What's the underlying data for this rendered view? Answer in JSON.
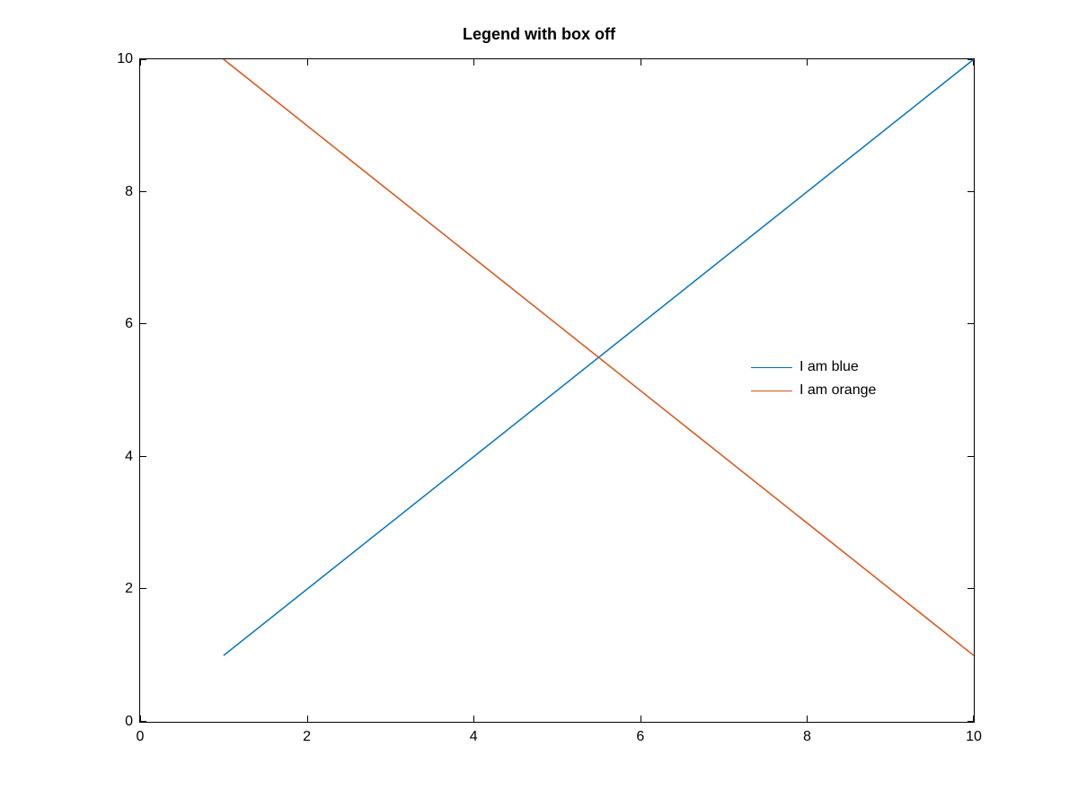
{
  "chart_data": {
    "type": "line",
    "title": "Legend with box off",
    "xlabel": "",
    "ylabel": "",
    "xlim": [
      0,
      10
    ],
    "ylim": [
      0,
      10
    ],
    "xticks": [
      0,
      2,
      4,
      6,
      8,
      10
    ],
    "yticks": [
      0,
      2,
      4,
      6,
      8,
      10
    ],
    "x": [
      1,
      2,
      3,
      4,
      5,
      6,
      7,
      8,
      9,
      10
    ],
    "series": [
      {
        "name": "I am blue",
        "color": "#0072BD",
        "values": [
          1,
          2,
          3,
          4,
          5,
          6,
          7,
          8,
          9,
          10
        ]
      },
      {
        "name": "I am orange",
        "color": "#D95319",
        "values": [
          10,
          9,
          8,
          7,
          6,
          5,
          4,
          3,
          2,
          1
        ]
      }
    ],
    "legend": {
      "box": "off",
      "position": "east"
    },
    "grid": false
  }
}
